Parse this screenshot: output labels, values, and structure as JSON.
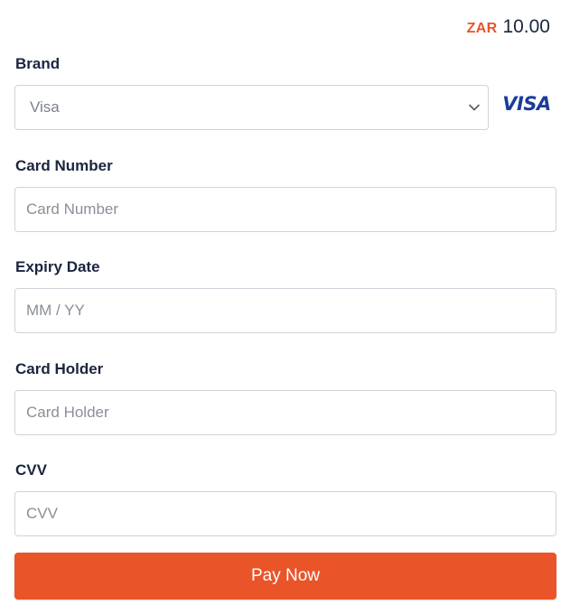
{
  "amount": {
    "currency": "ZAR",
    "value": "10.00"
  },
  "brand": {
    "label": "Brand",
    "selected": "Visa",
    "logo_text": "VISA",
    "icon": "visa-logo"
  },
  "card_number": {
    "label": "Card Number",
    "placeholder": "Card Number"
  },
  "expiry": {
    "label": "Expiry Date",
    "placeholder": "MM / YY"
  },
  "holder": {
    "label": "Card Holder",
    "placeholder": "Card Holder"
  },
  "cvv": {
    "label": "CVV",
    "placeholder": "CVV"
  },
  "pay_button": {
    "label": "Pay Now"
  },
  "colors": {
    "accent": "#ea5429",
    "text": "#1b2540",
    "visa_blue": "#1a3c9c"
  }
}
